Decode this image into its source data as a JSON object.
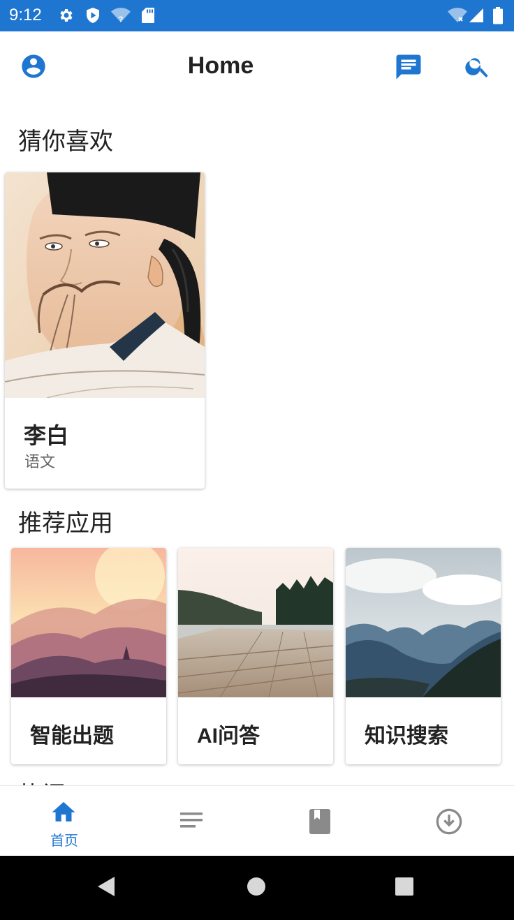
{
  "status_bar": {
    "time": "9:12",
    "icons": [
      "gear-icon",
      "shield-play-icon",
      "wifi-question-icon",
      "sd-card-icon",
      "wifi-x-icon",
      "signal-icon",
      "battery-icon"
    ]
  },
  "header": {
    "title": "Home",
    "left_icon": "account-circle-icon",
    "right_icons": [
      "message-icon",
      "search-icon"
    ]
  },
  "sections": {
    "guess_like": "猜你喜欢",
    "recommended": "推荐应用",
    "partial_next": "热门"
  },
  "guess_card": {
    "name": "李白",
    "subject": "语文"
  },
  "recommended_apps": [
    {
      "label": "智能出题"
    },
    {
      "label": "AI问答"
    },
    {
      "label": "知识搜索"
    }
  ],
  "bottom_nav": {
    "items": [
      {
        "label": "首页",
        "icon": "home-icon",
        "active": true
      },
      {
        "label": "",
        "icon": "list-icon",
        "active": false
      },
      {
        "label": "",
        "icon": "book-icon",
        "active": false
      },
      {
        "label": "",
        "icon": "download-icon",
        "active": false
      }
    ]
  },
  "colors": {
    "primary": "#1e76d1",
    "inactive_icon": "#8a8a8a",
    "text": "#222222"
  }
}
